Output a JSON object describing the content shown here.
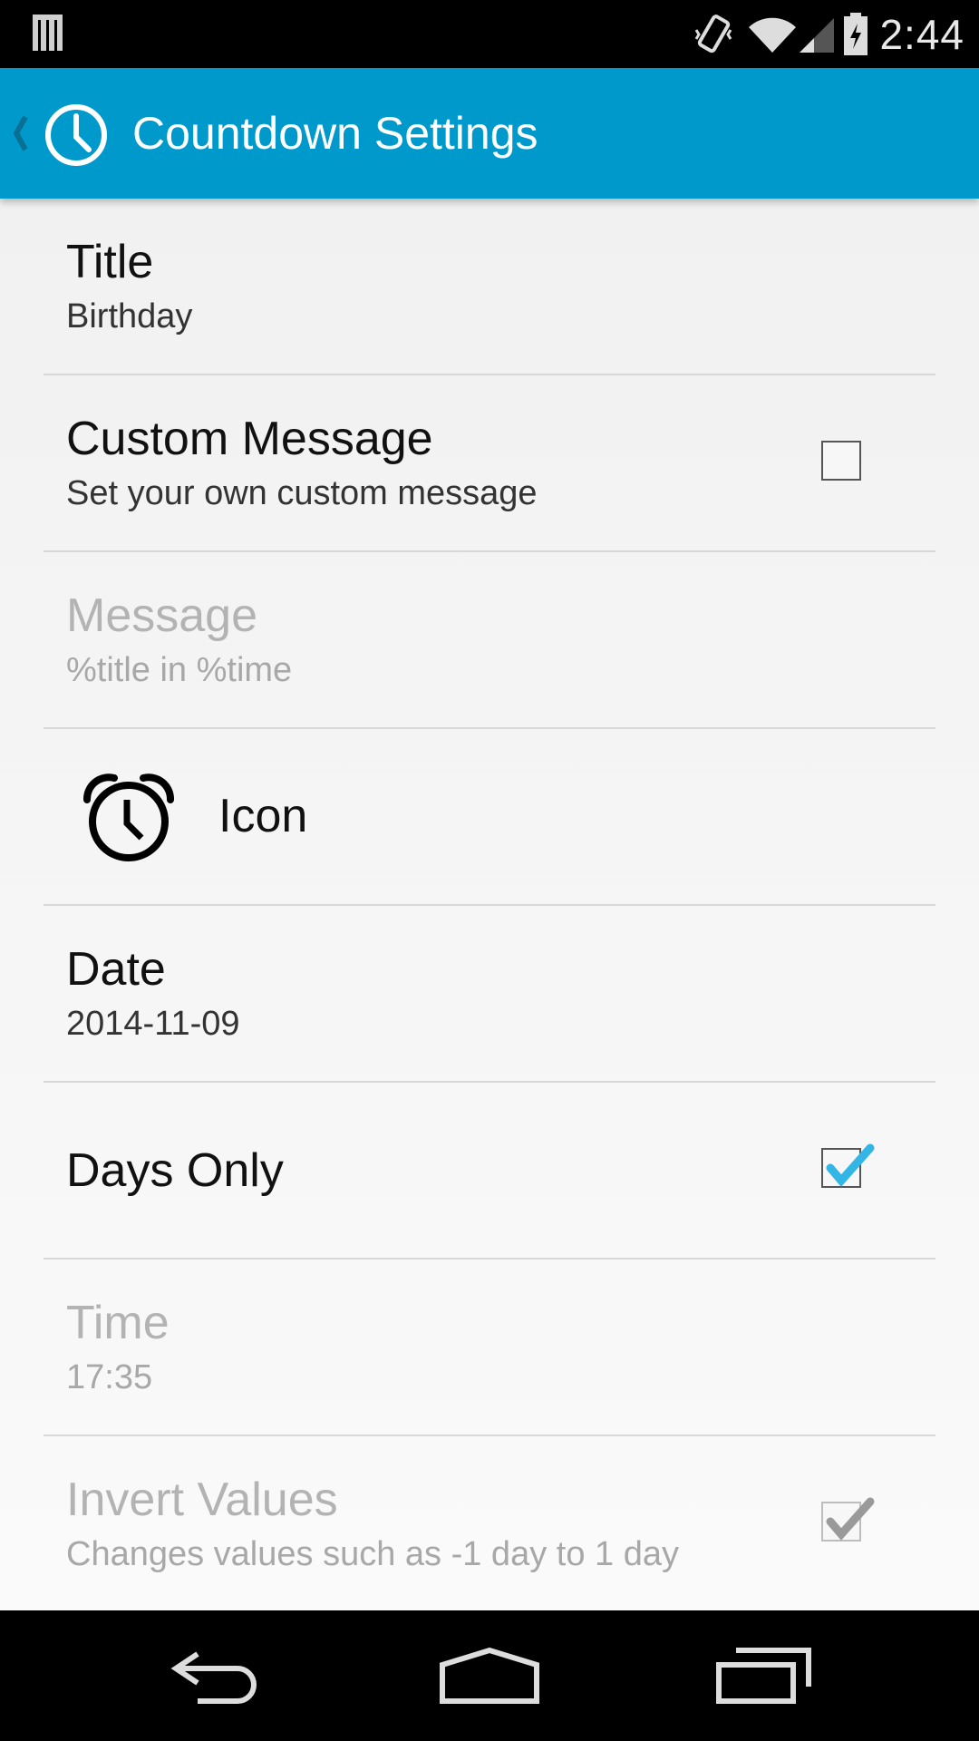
{
  "status_bar": {
    "time": "2:44",
    "icons": [
      "notification-bars-icon",
      "vibrate-icon",
      "wifi-icon",
      "cell-signal-icon",
      "battery-charging-icon"
    ]
  },
  "action_bar": {
    "title": "Countdown Settings",
    "icon": "clock-icon",
    "background": "#0099cc"
  },
  "preferences": [
    {
      "title": "Title",
      "summary": "Birthday",
      "enabled": true
    },
    {
      "title": "Custom Message",
      "summary": "Set your own custom message",
      "checked": false,
      "enabled": true
    },
    {
      "title": "Message",
      "summary": "%title in %time",
      "enabled": false
    },
    {
      "title": "Icon",
      "icon": "alarm-clock-icon",
      "enabled": true
    },
    {
      "title": "Date",
      "summary": "2014-11-09",
      "enabled": true
    },
    {
      "title": "Days Only",
      "checked": true,
      "enabled": true
    },
    {
      "title": "Time",
      "summary": "17:35",
      "enabled": false
    },
    {
      "title": "Invert Values",
      "summary": "Changes values such as -1 day to 1 day",
      "checked": true,
      "enabled": false
    }
  ],
  "nav_bar": {
    "buttons": [
      "back-icon",
      "home-icon",
      "recents-icon"
    ]
  },
  "colors": {
    "accent": "#33b5e5",
    "disabled_text": "#b3b3b3"
  }
}
